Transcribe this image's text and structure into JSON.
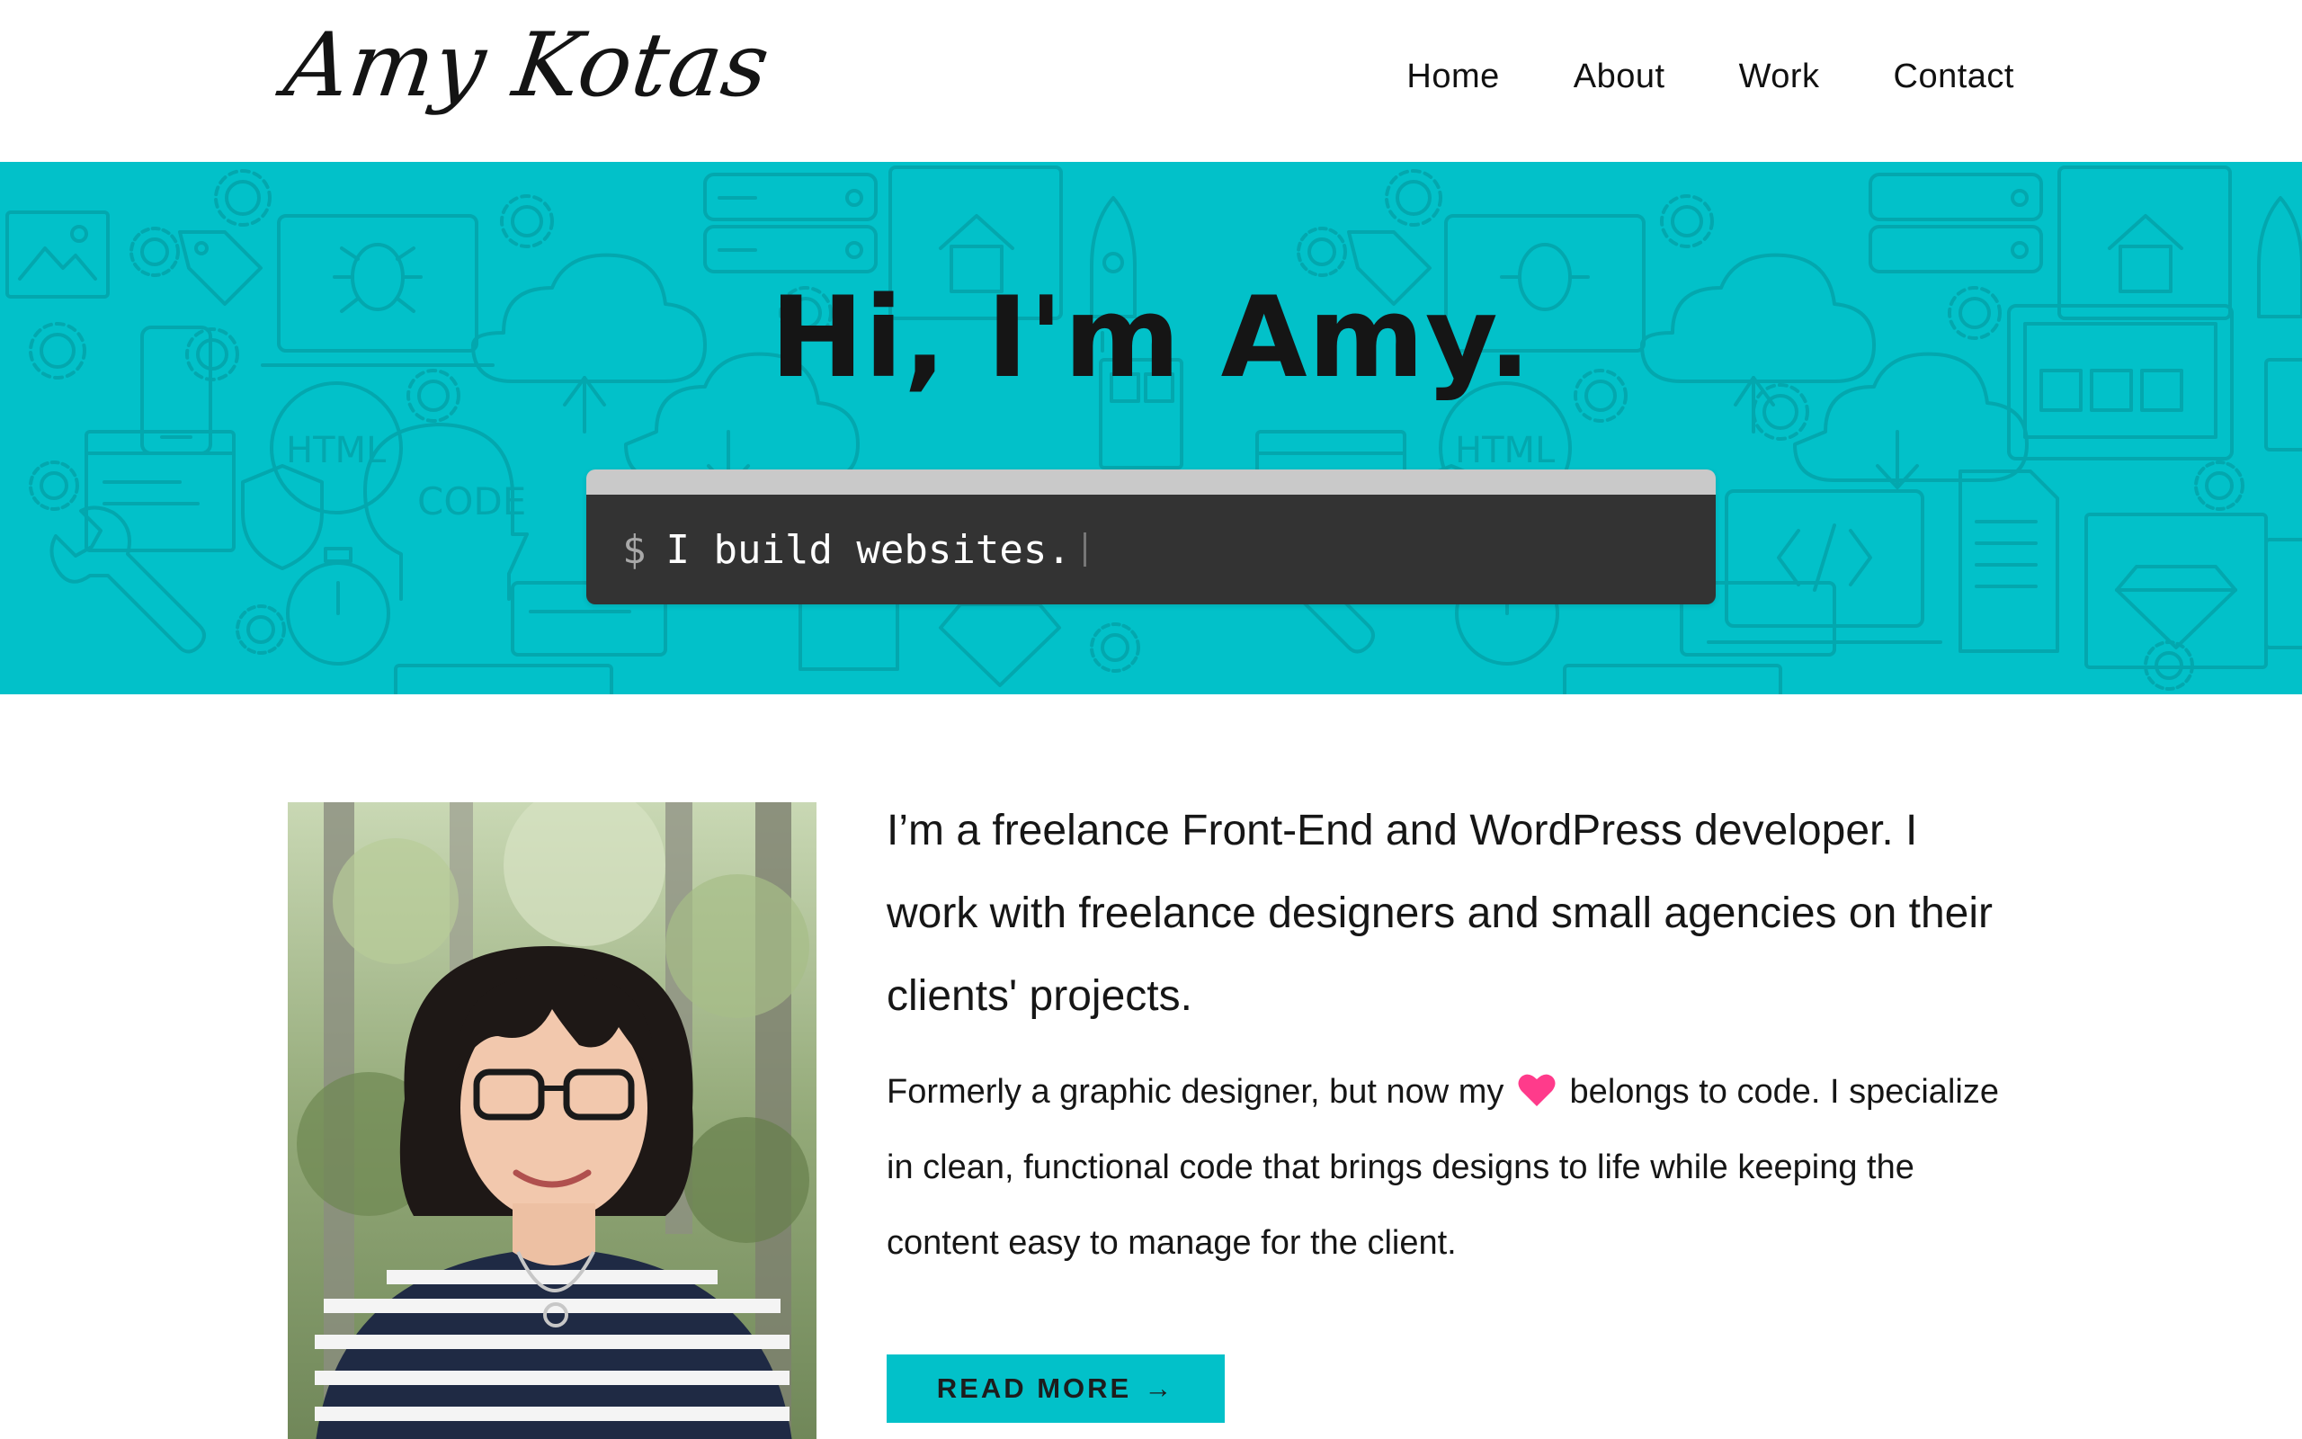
{
  "header": {
    "logo_text": "Amy Kotas",
    "nav": [
      {
        "label": "Home"
      },
      {
        "label": "About"
      },
      {
        "label": "Work"
      },
      {
        "label": "Contact"
      }
    ]
  },
  "hero": {
    "title": "Hi, I'm Amy.",
    "terminal": {
      "prompt": "$",
      "command": "I build websites."
    },
    "background_color": "#02c1c9",
    "pattern_icons": [
      "image-icon",
      "gear-icon",
      "tag-icon",
      "laptop-icon",
      "bug-icon",
      "cloud-upload-icon",
      "cloud-download-icon",
      "server-icon",
      "browser-home-icon",
      "rocket-icon",
      "html-icon",
      "code-head-icon",
      "shield-icon",
      "stopwatch-icon",
      "diamond-icon",
      "code-brackets-icon",
      "document-icon"
    ],
    "pattern_labels": [
      "HTML",
      "CODE"
    ]
  },
  "about": {
    "portrait_alt": "Photo of Amy",
    "intro": "I’m a freelance Front-End and WordPress developer. I work with freelance designers and small agencies on their clients' projects.",
    "detail_before": "Formerly a graphic designer, but now my",
    "detail_icon": "heart-icon",
    "detail_after": "belongs to code. I specialize in clean, functional code that brings designs to life while keeping the content easy to manage for the client.",
    "read_more_label": "READ MORE",
    "read_more_arrow": "→"
  },
  "colors": {
    "accent": "#02c1c9",
    "terminal_body": "#333333",
    "terminal_bar": "#c9c9c9",
    "heart": "#ff3b8b"
  }
}
